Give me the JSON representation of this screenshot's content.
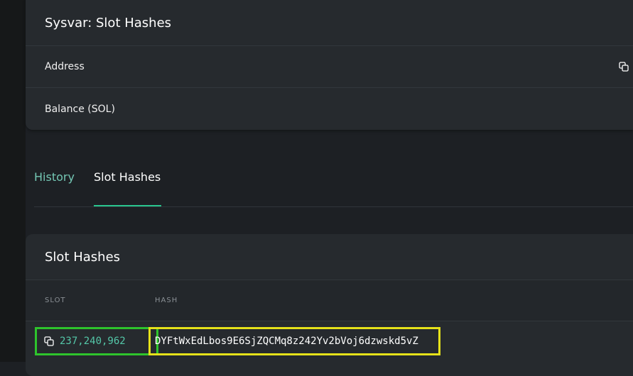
{
  "account": {
    "title": "Sysvar: Slot Hashes",
    "rows": [
      {
        "label": "Address"
      },
      {
        "label": "Balance (SOL)"
      }
    ]
  },
  "tabs": [
    {
      "label": "History"
    },
    {
      "label": "Slot Hashes"
    }
  ],
  "slot_hashes": {
    "title": "Slot Hashes",
    "columns": {
      "slot": "SLOT",
      "hash": "HASH"
    },
    "rows": [
      {
        "slot": "237,240,962",
        "hash": "DYFtWxEdLbos9E6SjZQCMq8z242Yv2bVoj6dzwskd5vZ"
      }
    ]
  },
  "colors": {
    "accent": "#29c68e",
    "slot_text": "#54c7a8",
    "highlight_green": "#2ec42c",
    "highlight_yellow": "#e6e21a"
  },
  "icons": {
    "address_copy": "copy-icon",
    "slot_copy": "copy-icon"
  }
}
